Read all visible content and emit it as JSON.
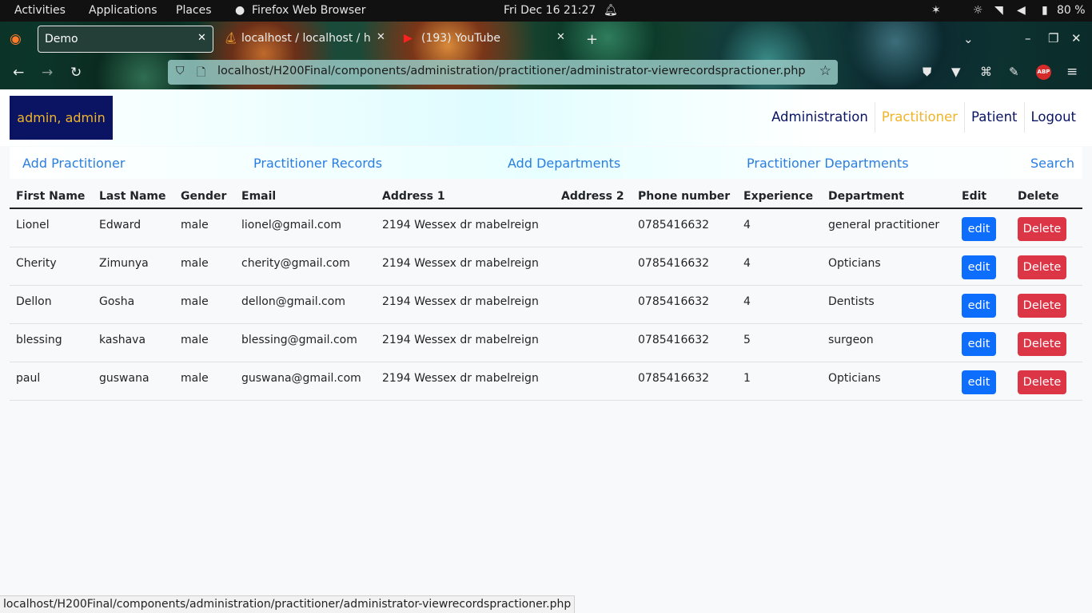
{
  "system_bar": {
    "activities": "Activities",
    "applications": "Applications",
    "places": "Places",
    "app_name": "Firefox Web Browser",
    "datetime": "Fri Dec 16  21:27",
    "battery": "80 %"
  },
  "browser": {
    "tabs": [
      {
        "label": "Demo",
        "active": true
      },
      {
        "label": "localhost / localhost / hit",
        "active": false
      },
      {
        "label": "(193) YouTube",
        "active": false
      }
    ],
    "url": "localhost/H200Final/components/administration/practitioner/administrator-viewrecordspractioner.php",
    "status_url": "localhost/H200Final/components/administration/practitioner/administrator-viewrecordspractioner.php",
    "abp_label": "ABP"
  },
  "header": {
    "brand": "admin, admin",
    "nav": [
      "Administration",
      "Practitioner",
      "Patient",
      "Logout"
    ]
  },
  "subnav": [
    "Add Practitioner",
    "Practitioner Records",
    "Add Departments",
    "Practitioner Departments",
    "Search"
  ],
  "table": {
    "columns": [
      "First Name",
      "Last Name",
      "Gender",
      "Email",
      "Address 1",
      "Address 2",
      "Phone number",
      "Experience",
      "Department",
      "Edit",
      "Delete"
    ],
    "edit_label": "edit",
    "delete_label": "Delete",
    "rows": [
      [
        "Lionel",
        "Edward",
        "male",
        "lionel@gmail.com",
        "2194 Wessex dr mabelreign",
        "",
        "0785416632",
        "4",
        "general practitioner"
      ],
      [
        "Cherity",
        "Zimunya",
        "male",
        "cherity@gmail.com",
        "2194 Wessex dr mabelreign",
        "",
        "0785416632",
        "4",
        "Opticians"
      ],
      [
        "Dellon",
        "Gosha",
        "male",
        "dellon@gmail.com",
        "2194 Wessex dr mabelreign",
        "",
        "0785416632",
        "4",
        "Dentists"
      ],
      [
        "blessing",
        "kashava",
        "male",
        "blessing@gmail.com",
        "2194 Wessex dr mabelreign",
        "",
        "0785416632",
        "5",
        "surgeon"
      ],
      [
        "paul",
        "guswana",
        "male",
        "guswana@gmail.com",
        "2194 Wessex dr mabelreign",
        "",
        "0785416632",
        "1",
        "Opticians"
      ]
    ]
  },
  "colors": {
    "brand_bg": "#0a1463",
    "accent": "#f0b42a",
    "link": "#2a7de1",
    "edit": "#0d6efd",
    "delete": "#dc3545"
  }
}
